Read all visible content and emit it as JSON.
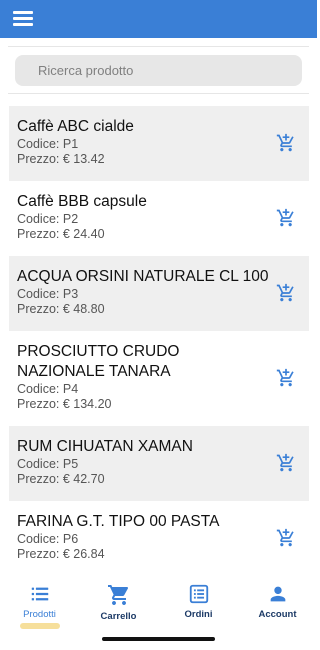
{
  "search": {
    "placeholder": "Ricerca prodotto"
  },
  "products": [
    {
      "name": "Caffè ABC cialde",
      "code": "Codice: P1",
      "price": "Prezzo: € 13.42"
    },
    {
      "name": "Caffè BBB capsule",
      "code": "Codice: P2",
      "price": "Prezzo: € 24.40"
    },
    {
      "name": "ACQUA ORSINI NATURALE CL 100",
      "code": "Codice: P3",
      "price": "Prezzo: € 48.80"
    },
    {
      "name": "PROSCIUTTO CRUDO NAZIONALE TANARA",
      "code": "Codice: P4",
      "price": "Prezzo: € 134.20"
    },
    {
      "name": "RUM CIHUATAN XAMAN",
      "code": "Codice: P5",
      "price": "Prezzo: € 42.70"
    },
    {
      "name": "FARINA G.T. TIPO 00 PASTA",
      "code": "Codice: P6",
      "price": "Prezzo: € 26.84"
    }
  ],
  "tabs": [
    {
      "label": "Prodotti",
      "icon": "list-icon",
      "active": true
    },
    {
      "label": "Carrello",
      "icon": "cart-icon"
    },
    {
      "label": "Ordini",
      "icon": "orders-icon"
    },
    {
      "label": "Account",
      "icon": "account-icon"
    }
  ],
  "colors": {
    "brand": "#3a7fd6",
    "tab_text": "#1c3a66",
    "row_shade": "#efefef"
  }
}
